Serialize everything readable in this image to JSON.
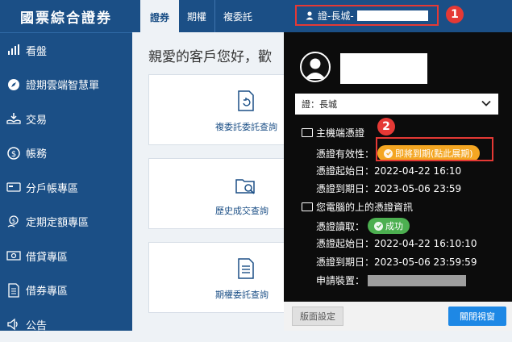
{
  "app": {
    "title": "國票綜合證券"
  },
  "tabs": [
    {
      "label": "證券"
    },
    {
      "label": "期權"
    },
    {
      "label": "複委託"
    }
  ],
  "user_tab": {
    "label": "證-長城-"
  },
  "annotations": {
    "badge1": "1",
    "badge2": "2"
  },
  "sidebar": {
    "items": [
      {
        "label": "看盤",
        "icon": "chart-icon"
      },
      {
        "label": "證期雲端智慧單",
        "icon": "compass-icon"
      },
      {
        "label": "交易",
        "icon": "hand-coin-icon"
      },
      {
        "label": "帳務",
        "icon": "dollar-icon"
      },
      {
        "label": "分戶帳專區",
        "icon": "card-icon"
      },
      {
        "label": "定期定額專區",
        "icon": "coin-hand-icon"
      },
      {
        "label": "借貸專區",
        "icon": "money-icon"
      },
      {
        "label": "借券專區",
        "icon": "document-icon"
      },
      {
        "label": "公告",
        "icon": "speaker-icon"
      }
    ]
  },
  "main": {
    "greeting": "親愛的客戶您好，歡",
    "cards": [
      {
        "label": "複委託委託查詢",
        "icon": "document-refresh-icon"
      },
      {
        "label": "歷史成交查詢",
        "icon": "folder-search-icon"
      },
      {
        "label": "期權委託查詢",
        "icon": "document-list-icon"
      }
    ]
  },
  "panel": {
    "account_select": "證：長城",
    "host_section": "主機端憑證",
    "host_validity_label": "憑證有效性：",
    "host_validity_status": "即將到期(點此展期)",
    "host_start": "憑證起始日：2022-04-22 16:10",
    "host_end": "憑證到期日：2023-05-06 23:59",
    "pc_section": "您電腦的上的憑證資訊",
    "pc_read_label": "憑證讀取：",
    "pc_read_status": "成功",
    "pc_start": "憑證起始日：2022-04-22 16:10:10",
    "pc_end": "憑證到期日：2023-05-06 23:59:59",
    "device_label": "申請裝置：",
    "footer": {
      "settings_button": "版面設定",
      "close_button": "關閉視窗"
    }
  },
  "colors": {
    "primary": "#1b4f86",
    "panel_bg": "#0c0c0c",
    "warn": "#f4a622",
    "ok": "#4caf50",
    "highlight": "#e53935",
    "button_blue": "#1e88e5"
  }
}
